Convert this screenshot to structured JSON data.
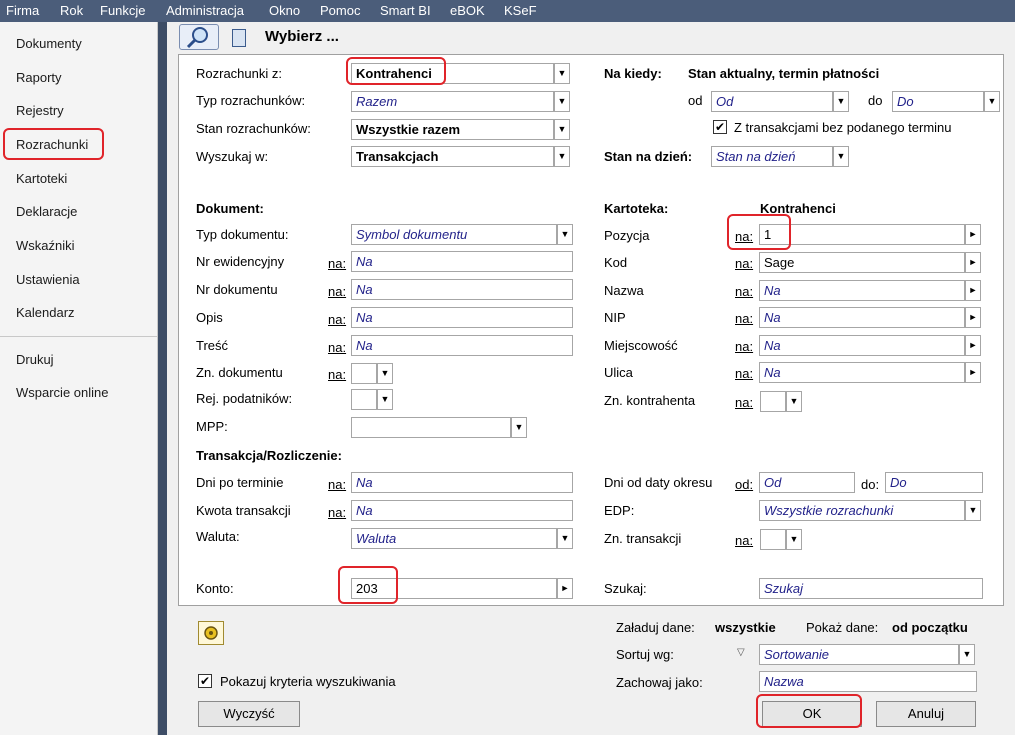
{
  "menu": [
    "Firma",
    "Rok",
    "Funkcje",
    "Administracja",
    "Okno",
    "Pomoc",
    "Smart BI",
    "eBOK",
    "KSeF"
  ],
  "sidebar": {
    "items": [
      "Dokumenty",
      "Raporty",
      "Rejestry",
      "Rozrachunki",
      "Kartoteki",
      "Deklaracje",
      "Wskaźniki",
      "Ustawienia",
      "Kalendarz"
    ],
    "bottom_items": [
      "Drukuj",
      "Wsparcie online"
    ]
  },
  "dialog": {
    "title": "Wybierz ...",
    "left": {
      "rozrachunki_z": {
        "label": "Rozrachunki z:",
        "value": "Kontrahenci"
      },
      "typ_rozrachunkow": {
        "label": "Typ rozrachunków:",
        "value": "Razem"
      },
      "stan_rozrachunkow": {
        "label": "Stan rozrachunków:",
        "value": "Wszystkie razem"
      },
      "wyszukaj_w": {
        "label": "Wyszukaj w:",
        "value": "Transakcjach"
      }
    },
    "right": {
      "na_kiedy_label": "Na kiedy:",
      "na_kiedy_value": "Stan aktualny, termin płatności",
      "od_label": "od",
      "od_value": "Od",
      "do_label": "do",
      "do_value": "Do",
      "bez_terminu": "Z transakcjami bez podanego terminu",
      "stan_na_dzien_label": "Stan na dzień:",
      "stan_na_dzien_value": "Stan na dzień"
    },
    "dokument": {
      "header": "Dokument:",
      "typ_label": "Typ dokumentu:",
      "typ_value": "Symbol dokumentu",
      "na": "na:",
      "nr_ewid_label": "Nr ewidencyjny",
      "nr_dok_label": "Nr dokumentu",
      "opis_label": "Opis",
      "tresc_label": "Treść",
      "zn_dok_label": "Zn. dokumentu",
      "rej_pod_label": "Rej. podatników:",
      "mpp_label": "MPP:",
      "na_value": "Na"
    },
    "kartoteka": {
      "header": "Kartoteka:",
      "header_value": "Kontrahenci",
      "pozycja_label": "Pozycja",
      "pozycja_value": "1",
      "kod_label": "Kod",
      "kod_value": "Sage",
      "nazwa_label": "Nazwa",
      "nip_label": "NIP",
      "miejsc_label": "Miejscowość",
      "ulica_label": "Ulica",
      "zn_kontr_label": "Zn. kontrahenta"
    },
    "transakcja": {
      "header": "Transakcja/Rozliczenie:",
      "dni_po_label": "Dni po terminie",
      "kwota_label": "Kwota transakcji",
      "waluta_label": "Waluta:",
      "waluta_value": "Waluta",
      "dni_od_label": "Dni od daty okresu",
      "od_label": "od:",
      "od_value": "Od",
      "do_label": "do:",
      "do_value": "Do",
      "edp_label": "EDP:",
      "edp_value": "Wszystkie rozrachunki",
      "zn_trans_label": "Zn. transakcji"
    },
    "konto_label": "Konto:",
    "konto_value": "203",
    "szukaj_label": "Szukaj:",
    "szukaj_value": "Szukaj",
    "zaladuj_label": "Załaduj dane:",
    "zaladuj_value": "wszystkie",
    "pokaz_label": "Pokaż dane:",
    "pokaz_value": "od początku",
    "sortuj_label": "Sortuj wg:",
    "sortuj_value": "Sortowanie",
    "zachowaj_label": "Zachowaj jako:",
    "zachowaj_value": "Nazwa",
    "pokazuj_kryteria": "Pokazuj kryteria wyszukiwania",
    "wyczysc": "Wyczyść",
    "ok": "OK",
    "anuluj": "Anuluj"
  },
  "colors": {
    "menubar": "#4b5d7a",
    "highlight": "#e0242a",
    "placeholder": "#22228a"
  }
}
